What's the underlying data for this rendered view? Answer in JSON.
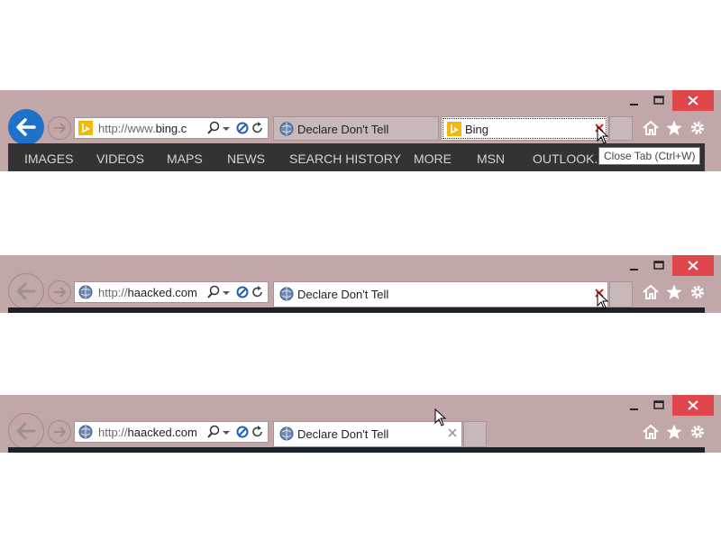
{
  "colors": {
    "chrome": "#c2a7a8",
    "close_red": "#e0474c",
    "back_blue": "#2072c9",
    "bing_nav": "#333333",
    "bing_yellow": "#f5b70a"
  },
  "panels": [
    {
      "address": {
        "prefix": "http://www.",
        "domain": "bing.c",
        "site_icon": "bing-icon"
      },
      "tabs": [
        {
          "label": "Declare Don't Tell",
          "icon": "globe-icon",
          "state": "inactive"
        },
        {
          "label": "Bing",
          "icon": "bing-icon",
          "state": "active-focused"
        }
      ],
      "nav": [
        "IMAGES",
        "VIDEOS",
        "MAPS",
        "NEWS",
        "SEARCH HISTORY",
        "MORE",
        "MSN",
        "OUTLOOK.C"
      ],
      "tooltip": "Close Tab (Ctrl+W)"
    },
    {
      "address": {
        "prefix": "http://",
        "domain": "haacked.com",
        "site_icon": "globe-icon"
      },
      "tabs": [
        {
          "label": "Declare Don't Tell",
          "icon": "globe-icon",
          "state": "active"
        }
      ]
    },
    {
      "address": {
        "prefix": "http://",
        "domain": "haacked.com",
        "site_icon": "globe-icon"
      },
      "tabs": [
        {
          "label": "Declare Don't Tell",
          "icon": "globe-icon",
          "state": "active"
        }
      ]
    }
  ]
}
